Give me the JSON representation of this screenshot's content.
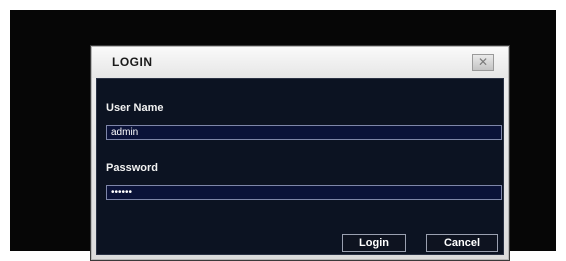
{
  "dialog": {
    "title": "LOGIN",
    "close_icon": "close-icon"
  },
  "form": {
    "username_label": "User Name",
    "username_value": "admin",
    "password_label": "Password",
    "password_value": "••••••"
  },
  "buttons": {
    "login_label": "Login",
    "cancel_label": "Cancel"
  },
  "colors": {
    "panel_background": "#0c1322",
    "input_background": "#0a1238",
    "title_bar": "#f0f0f0"
  }
}
